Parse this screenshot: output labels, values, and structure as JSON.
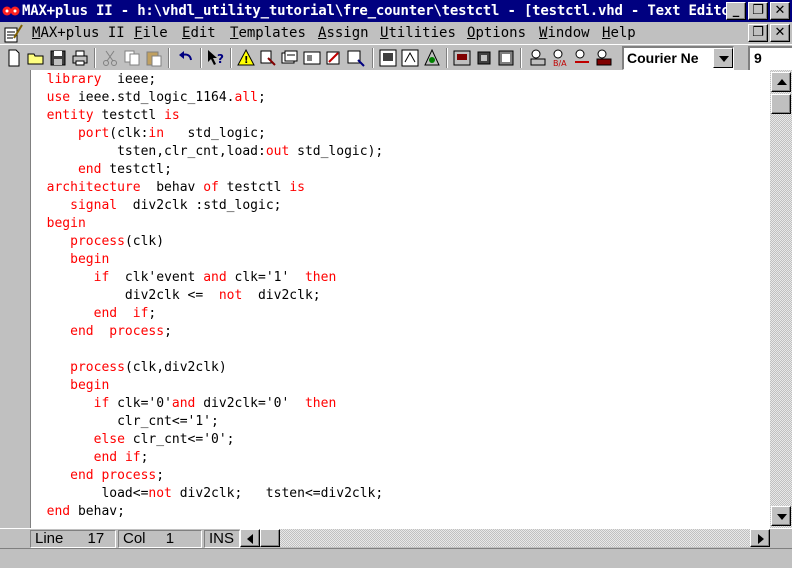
{
  "window": {
    "title": "MAX+plus II - h:\\vhdl_utility_tutorial\\fre_counter\\testctl - [testctl.vhd - Text Editor]",
    "controls": [
      "minimize",
      "restore",
      "close"
    ]
  },
  "menubar": {
    "items": [
      {
        "pre": "",
        "ul": "M",
        "post": "AX+plus II"
      },
      {
        "pre": "",
        "ul": "F",
        "post": "ile"
      },
      {
        "pre": "",
        "ul": "E",
        "post": "dit"
      },
      {
        "pre": "",
        "ul": "T",
        "post": "emplates"
      },
      {
        "pre": "",
        "ul": "A",
        "post": "ssign"
      },
      {
        "pre": "",
        "ul": "U",
        "post": "tilities"
      },
      {
        "pre": "",
        "ul": "O",
        "post": "ptions"
      },
      {
        "pre": "",
        "ul": "W",
        "post": "indow"
      },
      {
        "pre": "",
        "ul": "H",
        "post": "elp"
      }
    ]
  },
  "toolbar": {
    "font_name": "Courier Ne",
    "font_size": "9"
  },
  "colors": {
    "keyword": "#ff0000",
    "title_bg": "#000080",
    "chrome": "#c0c0c0"
  },
  "code": [
    [
      {
        "t": "  "
      },
      {
        "t": "library",
        "k": 1
      },
      {
        "t": "  ieee;"
      }
    ],
    [
      {
        "t": "  "
      },
      {
        "t": "use",
        "k": 1
      },
      {
        "t": " ieee.std_logic_1164."
      },
      {
        "t": "all",
        "k": 1
      },
      {
        "t": ";"
      }
    ],
    [
      {
        "t": "  "
      },
      {
        "t": "entity",
        "k": 1
      },
      {
        "t": " testctl "
      },
      {
        "t": "is",
        "k": 1
      }
    ],
    [
      {
        "t": "      "
      },
      {
        "t": "port",
        "k": 1
      },
      {
        "t": "(clk:"
      },
      {
        "t": "in",
        "k": 1
      },
      {
        "t": "   std_logic;"
      }
    ],
    [
      {
        "t": "           tsten,clr_cnt,load:"
      },
      {
        "t": "out",
        "k": 1
      },
      {
        "t": " std_logic);"
      }
    ],
    [
      {
        "t": "      "
      },
      {
        "t": "end",
        "k": 1
      },
      {
        "t": " testctl;"
      }
    ],
    [
      {
        "t": "  "
      },
      {
        "t": "architecture",
        "k": 1
      },
      {
        "t": "  behav "
      },
      {
        "t": "of",
        "k": 1
      },
      {
        "t": " testctl "
      },
      {
        "t": "is",
        "k": 1
      }
    ],
    [
      {
        "t": "     "
      },
      {
        "t": "signal",
        "k": 1
      },
      {
        "t": "  div2clk :std_logic;"
      }
    ],
    [
      {
        "t": "  "
      },
      {
        "t": "begin",
        "k": 1
      }
    ],
    [
      {
        "t": "     "
      },
      {
        "t": "process",
        "k": 1
      },
      {
        "t": "(clk)"
      }
    ],
    [
      {
        "t": "     "
      },
      {
        "t": "begin",
        "k": 1
      }
    ],
    [
      {
        "t": "        "
      },
      {
        "t": "if",
        "k": 1
      },
      {
        "t": "  clk'event "
      },
      {
        "t": "and",
        "k": 1
      },
      {
        "t": " clk='1'  "
      },
      {
        "t": "then",
        "k": 1
      }
    ],
    [
      {
        "t": "            div2clk <=  "
      },
      {
        "t": "not",
        "k": 1
      },
      {
        "t": "  div2clk;"
      }
    ],
    [
      {
        "t": "        "
      },
      {
        "t": "end",
        "k": 1
      },
      {
        "t": "  "
      },
      {
        "t": "if",
        "k": 1
      },
      {
        "t": ";"
      }
    ],
    [
      {
        "t": "     "
      },
      {
        "t": "end",
        "k": 1
      },
      {
        "t": "  "
      },
      {
        "t": "process",
        "k": 1
      },
      {
        "t": ";"
      }
    ],
    [
      {
        "t": ""
      }
    ],
    [
      {
        "t": "     "
      },
      {
        "t": "process",
        "k": 1
      },
      {
        "t": "(clk,div2clk)"
      }
    ],
    [
      {
        "t": "     "
      },
      {
        "t": "begin",
        "k": 1
      }
    ],
    [
      {
        "t": "        "
      },
      {
        "t": "if",
        "k": 1
      },
      {
        "t": " clk='0'"
      },
      {
        "t": "and",
        "k": 1
      },
      {
        "t": " div2clk='0'  "
      },
      {
        "t": "then",
        "k": 1
      }
    ],
    [
      {
        "t": "           clr_cnt<='1';"
      }
    ],
    [
      {
        "t": "        "
      },
      {
        "t": "else",
        "k": 1
      },
      {
        "t": " clr_cnt<='0';"
      }
    ],
    [
      {
        "t": "        "
      },
      {
        "t": "end",
        "k": 1
      },
      {
        "t": " "
      },
      {
        "t": "if",
        "k": 1
      },
      {
        "t": ";"
      }
    ],
    [
      {
        "t": "     "
      },
      {
        "t": "end",
        "k": 1
      },
      {
        "t": " "
      },
      {
        "t": "process",
        "k": 1
      },
      {
        "t": ";"
      }
    ],
    [
      {
        "t": "         load<="
      },
      {
        "t": "not",
        "k": 1
      },
      {
        "t": " div2clk;   tsten<=div2clk;"
      }
    ],
    [
      {
        "t": "  "
      },
      {
        "t": "end",
        "k": 1
      },
      {
        "t": " behav;"
      }
    ]
  ],
  "statusbar": {
    "line_label": "Line",
    "line_value": "17",
    "col_label": "Col",
    "col_value": "1",
    "mode": "INS"
  }
}
